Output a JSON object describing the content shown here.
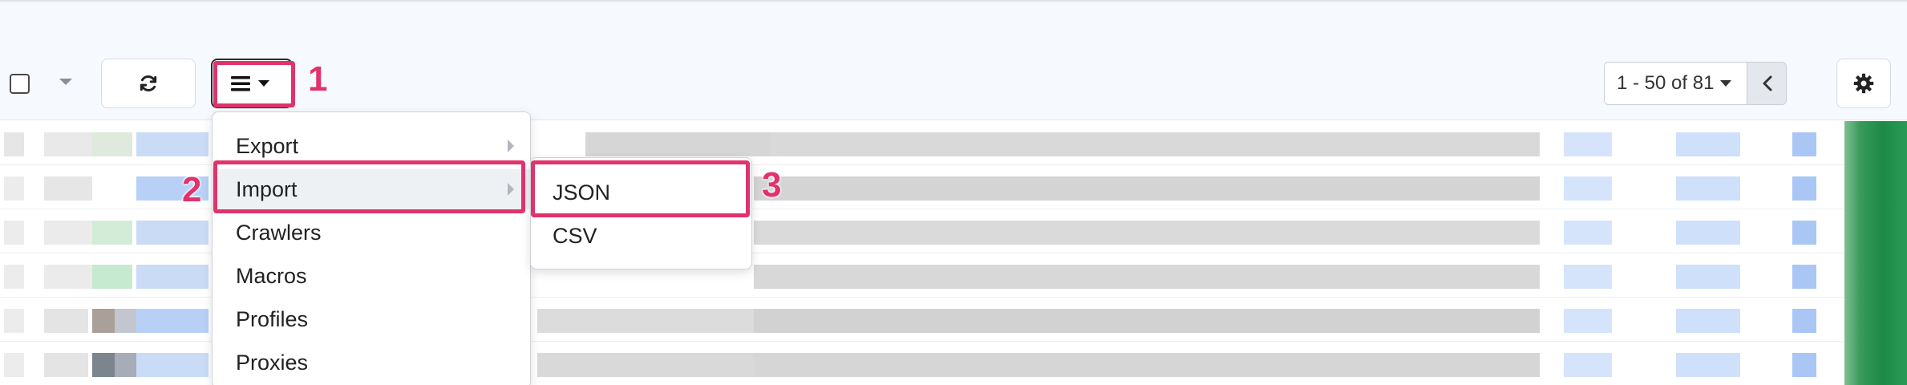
{
  "toolbar": {
    "checkbox": "select-all-checkbox",
    "refresh_icon": "refresh-icon",
    "menu_icon": "hamburger-icon",
    "gear_icon": "gear-icon"
  },
  "pager": {
    "range_label": "1 - 50 of 81"
  },
  "dropdown": {
    "items": [
      {
        "label": "Export",
        "has_submenu": true
      },
      {
        "label": "Import",
        "has_submenu": true
      },
      {
        "label": "Crawlers"
      },
      {
        "label": "Macros"
      },
      {
        "label": "Profiles"
      },
      {
        "label": "Proxies"
      }
    ]
  },
  "submenu": {
    "items": [
      {
        "label": "JSON"
      },
      {
        "label": "CSV"
      }
    ]
  },
  "annotations": {
    "step1": "1",
    "step2": "2",
    "step3": "3",
    "color": "#e0336c"
  }
}
